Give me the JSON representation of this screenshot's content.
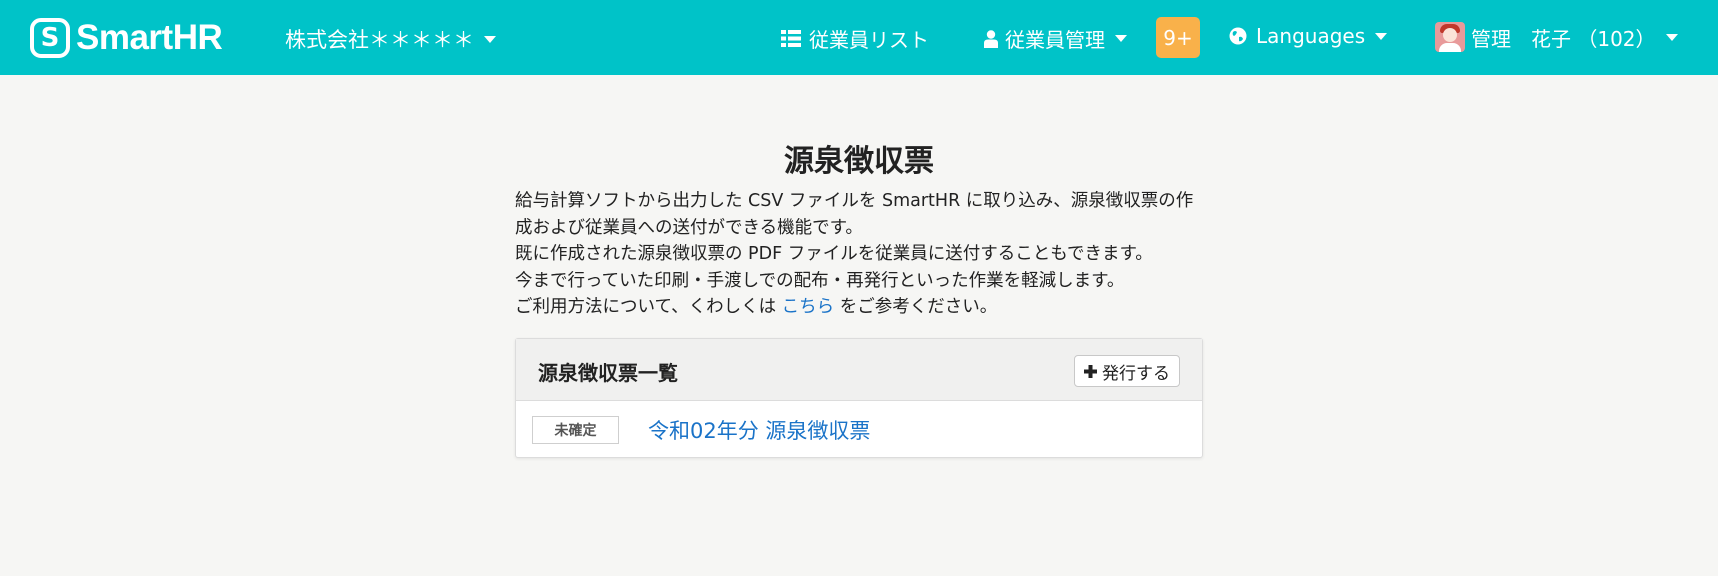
{
  "header": {
    "logo_text": "SmartHR",
    "company": "株式会社＊＊＊＊＊",
    "nav_list": "従業員リスト",
    "nav_manage": "従業員管理",
    "badge": "9+",
    "languages": "Languages",
    "user": "管理　花子 （102）"
  },
  "main": {
    "title": "源泉徴収票",
    "desc_line1": "給与計算ソフトから出力した CSV ファイルを SmartHR に取り込み、源泉徴収票の作成および従業員への送付ができる機能です。",
    "desc_line2": "既に作成された源泉徴収票の PDF ファイルを従業員に送付することもできます。",
    "desc_line3": "今まで行っていた印刷・手渡しでの配布・再発行といった作業を軽減します。",
    "desc_line4_prefix": "ご利用方法について、くわしくは ",
    "desc_link": "こちら",
    "desc_line4_suffix": " をご参考ください。"
  },
  "panel": {
    "title": "源泉徴収票一覧",
    "issue_button": "発行する",
    "rows": [
      {
        "status": "未確定",
        "label": "令和02年分 源泉徴収票"
      }
    ]
  },
  "colors": {
    "header_bg": "#00c3c8",
    "badge_bg": "#f9b14a",
    "link": "#1a73c8",
    "page_bg": "#f6f6f4"
  },
  "icons": [
    "smarthr-logo-icon",
    "list-icon",
    "person-icon",
    "globe-icon",
    "chevron-down-icon",
    "plus-icon",
    "avatar"
  ]
}
